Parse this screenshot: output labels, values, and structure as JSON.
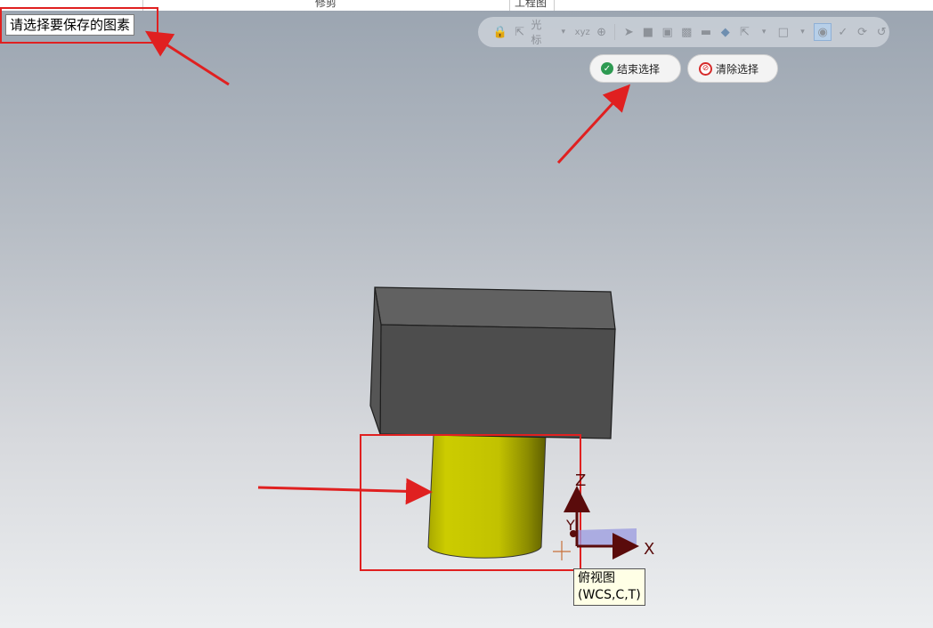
{
  "top_strip": {
    "left_fragment": "修剪",
    "right_fragment": "工程图"
  },
  "prompt": {
    "text": "请选择要保存的图素"
  },
  "toolbar": {
    "cursor_label": "光标",
    "xyz_label": "xyz"
  },
  "buttons": {
    "finish_select": "结束选择",
    "clear_select": "清除选择"
  },
  "triad": {
    "z_label": "Z",
    "x_label": "X",
    "y_label": "Y"
  },
  "view_tooltip": {
    "line1": "俯视图",
    "line2": "(WCS,C,T)"
  },
  "colors": {
    "box_top": "#616161",
    "box_front": "#4d4d4d",
    "box_side": "#555555",
    "cylinder": "#c8c700",
    "annotation_red": "#e02020"
  }
}
